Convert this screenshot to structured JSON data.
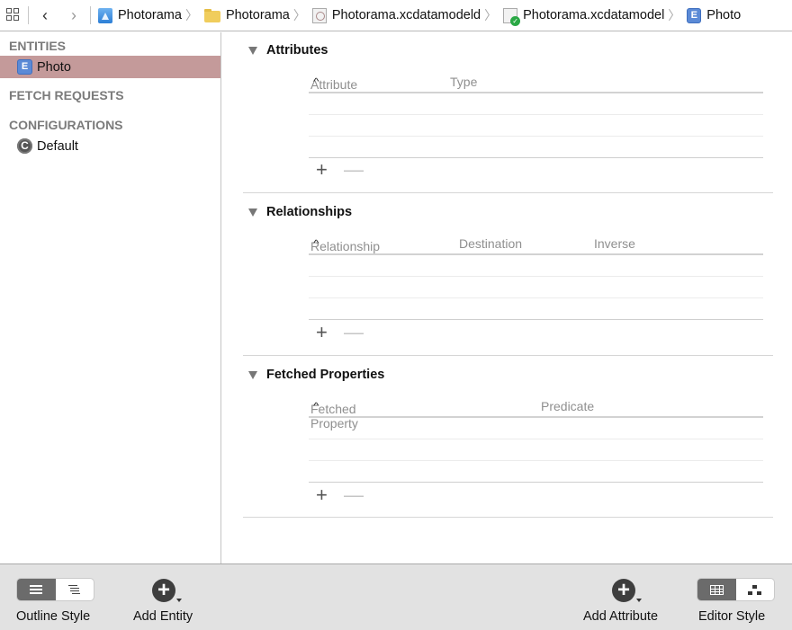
{
  "jumpbar": {
    "back_label": "‹",
    "forward_label": "›",
    "crumbs": [
      {
        "label": "Photorama",
        "icon": "app-project-icon"
      },
      {
        "label": "Photorama",
        "icon": "folder-icon"
      },
      {
        "label": "Photorama.xcdatamodeld",
        "icon": "datamodel-bundle-icon"
      },
      {
        "label": "Photorama.xcdatamodel",
        "icon": "datamodel-version-icon"
      },
      {
        "label": "Photo",
        "icon": "entity-icon"
      }
    ],
    "separator": "〉",
    "entity_glyph": "E"
  },
  "sidebar": {
    "entities_header": "ENTITIES",
    "entities": [
      {
        "label": "Photo",
        "glyph": "E",
        "selected": true
      }
    ],
    "fetch_requests_header": "FETCH REQUESTS",
    "configurations_header": "CONFIGURATIONS",
    "configurations": [
      {
        "label": "Default",
        "glyph": "C"
      }
    ]
  },
  "editor": {
    "attributes": {
      "title": "Attributes",
      "columns": [
        "Attribute",
        "Type"
      ],
      "sort_glyph": "^",
      "rows": [],
      "add_label": "+",
      "remove_label": "—"
    },
    "relationships": {
      "title": "Relationships",
      "columns": [
        "Relationship",
        "Destination",
        "Inverse"
      ],
      "sort_glyph": "^",
      "rows": [],
      "add_label": "+",
      "remove_label": "—"
    },
    "fetched_properties": {
      "title": "Fetched Properties",
      "columns": [
        "Fetched Property",
        "Predicate"
      ],
      "sort_glyph": "^",
      "rows": [],
      "add_label": "+",
      "remove_label": "—"
    }
  },
  "bottombar": {
    "outline_style_label": "Outline Style",
    "add_entity_label": "Add Entity",
    "add_attribute_label": "Add Attribute",
    "editor_style_label": "Editor Style",
    "add_glyph": "+",
    "outline_style_selected": "table",
    "editor_style_selected": "table"
  },
  "colors": {
    "selection": "#c49a9a",
    "entity_badge": "#5b8ad6",
    "toggle_on": "#6b6b6b",
    "bottom_bar": "#e2e2e2"
  }
}
